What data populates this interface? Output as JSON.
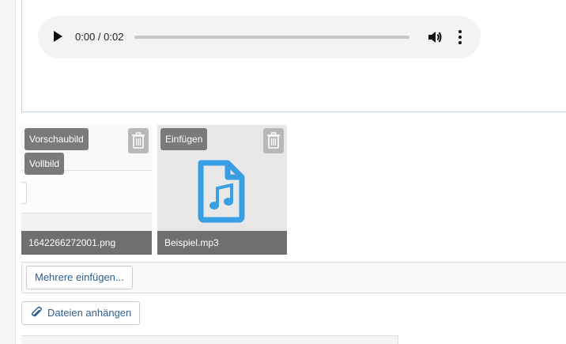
{
  "audio": {
    "time": "0:00 / 0:02",
    "progress": 0
  },
  "attachments": [
    {
      "filename": "1642266272001.png",
      "badges": [
        "Vorschaubild",
        "Vollbild"
      ],
      "kind": "image"
    },
    {
      "filename": "Beispiel.mp3",
      "badges": [
        "Einfügen"
      ],
      "kind": "audio"
    }
  ],
  "actions": {
    "insert_multiple": "Mehrere einfügen...",
    "attach_files": "Dateien anhängen"
  },
  "colors": {
    "accent": "#2f5f8f",
    "file_icon": "#3a9ee4"
  },
  "icons": {
    "play": "play-icon",
    "volume": "volume-icon",
    "more": "more-vertical-icon",
    "trash": "trash-icon",
    "audio_file": "audio-file-icon",
    "paperclip": "paperclip-icon"
  }
}
